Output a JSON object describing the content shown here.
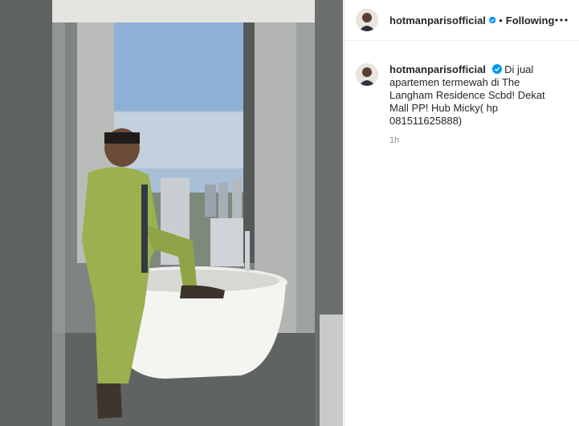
{
  "post": {
    "username": "hotmanparisofficial",
    "follow_status": "Following",
    "separator": "•",
    "caption": "Di jual apartemen termewah di The Langham Residence Scbd! Dekat Mall PP! Hub Micky( hp 081511625888)",
    "time_ago": "1h",
    "image_alt": "Man in green suit standing by a freestanding bathtub with a city view"
  },
  "icons": {
    "verified": "verified-badge-icon",
    "more": "more-options-icon"
  },
  "colors": {
    "verified_blue": "#0095f6",
    "text": "#262626",
    "muted": "#8e8e8e",
    "divider": "#dbdbdb"
  }
}
